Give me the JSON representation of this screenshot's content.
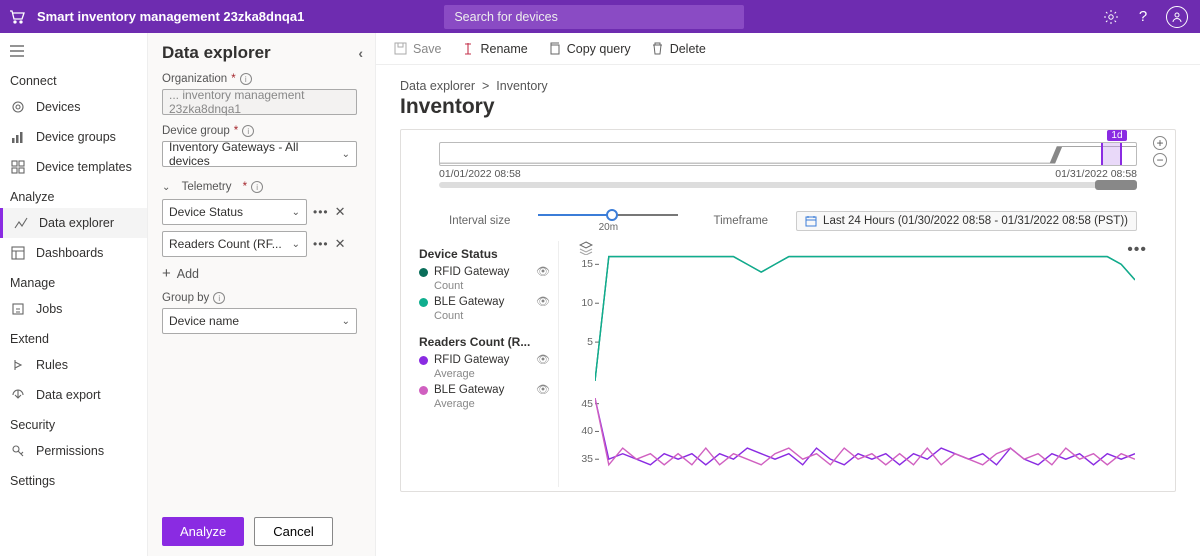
{
  "topbar": {
    "app_title": "Smart inventory management 23zka8dnqa1",
    "search_placeholder": "Search for devices"
  },
  "sidebar": {
    "sections": [
      {
        "label": "Connect",
        "items": [
          {
            "label": "Devices"
          },
          {
            "label": "Device groups"
          },
          {
            "label": "Device templates"
          }
        ]
      },
      {
        "label": "Analyze",
        "items": [
          {
            "label": "Data explorer",
            "active": true
          },
          {
            "label": "Dashboards"
          }
        ]
      },
      {
        "label": "Manage",
        "items": [
          {
            "label": "Jobs"
          }
        ]
      },
      {
        "label": "Extend",
        "items": [
          {
            "label": "Rules"
          },
          {
            "label": "Data export"
          }
        ]
      },
      {
        "label": "Security",
        "items": [
          {
            "label": "Permissions"
          }
        ]
      },
      {
        "label": "Settings",
        "items": []
      }
    ]
  },
  "explorer": {
    "title": "Data explorer",
    "org_label": "Organization",
    "org_value": "... inventory management 23zka8dnqa1",
    "dg_label": "Device group",
    "dg_value": "Inventory Gateways - All devices",
    "tel_label": "Telemetry",
    "tel1": "Device Status",
    "tel2": "Readers Count (RF...",
    "add_label": "Add",
    "group_label": "Group by",
    "group_value": "Device name",
    "analyze_btn": "Analyze",
    "cancel_btn": "Cancel"
  },
  "toolbar": {
    "save": "Save",
    "rename": "Rename",
    "copy": "Copy query",
    "delete": "Delete"
  },
  "breadcrumb": {
    "root": "Data explorer",
    "leaf": "Inventory"
  },
  "page_title": "Inventory",
  "timeline": {
    "start": "01/01/2022 08:58",
    "end": "01/31/2022 08:58",
    "badge": "1d"
  },
  "controls": {
    "interval_label": "Interval size",
    "interval_value": "20m",
    "timeframe_label": "Timeframe",
    "timeframe_value": "Last 24 Hours (01/30/2022 08:58 - 01/31/2022 08:58 (PST))"
  },
  "legend": {
    "g1": {
      "title": "Device Status",
      "s1": {
        "name": "RFID Gateway",
        "agg": "Count",
        "color": "#0a6e5a"
      },
      "s2": {
        "name": "BLE Gateway",
        "agg": "Count",
        "color": "#0fae8e"
      }
    },
    "g2": {
      "title": "Readers Count (R...",
      "s1": {
        "name": "RFID Gateway",
        "agg": "Average",
        "color": "#8a2be2"
      },
      "s2": {
        "name": "BLE Gateway",
        "agg": "Average",
        "color": "#d060c0"
      }
    }
  },
  "chart_data": [
    {
      "type": "line",
      "title": "Device Status",
      "yticks": [
        5,
        10,
        15
      ],
      "ylim": [
        0,
        18
      ],
      "series": [
        {
          "name": "RFID Gateway",
          "color": "#0a6e5a",
          "values": [
            0,
            16,
            16,
            16,
            16,
            16,
            16,
            16,
            16,
            16,
            16,
            15,
            14,
            15,
            16,
            16,
            16,
            16,
            16,
            16,
            16,
            16,
            16,
            16,
            16,
            16,
            16,
            16,
            16,
            16,
            16,
            16,
            16,
            16,
            16,
            16,
            16,
            16,
            15,
            13
          ]
        },
        {
          "name": "BLE Gateway",
          "color": "#0fae8e",
          "values": [
            0,
            16,
            16,
            16,
            16,
            16,
            16,
            16,
            16,
            16,
            16,
            15,
            14,
            15,
            16,
            16,
            16,
            16,
            16,
            16,
            16,
            16,
            16,
            16,
            16,
            16,
            16,
            16,
            16,
            16,
            16,
            16,
            16,
            16,
            16,
            16,
            16,
            16,
            15,
            13
          ]
        }
      ]
    },
    {
      "type": "line",
      "title": "Readers Count",
      "yticks": [
        35,
        40,
        45
      ],
      "ylim": [
        30,
        48
      ],
      "series": [
        {
          "name": "RFID Gateway",
          "color": "#8a2be2",
          "values": [
            46,
            35,
            36,
            35,
            34,
            36,
            35,
            36,
            34,
            36,
            35,
            37,
            36,
            35,
            36,
            34,
            37,
            35,
            34,
            36,
            35,
            36,
            34,
            36,
            35,
            37,
            36,
            35,
            36,
            34,
            37,
            35,
            34,
            36,
            35,
            36,
            34,
            36,
            35,
            36
          ]
        },
        {
          "name": "BLE Gateway",
          "color": "#d060c0",
          "values": [
            46,
            34,
            37,
            35,
            36,
            34,
            36,
            34,
            37,
            34,
            36,
            35,
            34,
            36,
            37,
            35,
            36,
            34,
            37,
            35,
            36,
            34,
            36,
            34,
            37,
            34,
            36,
            35,
            34,
            36,
            37,
            35,
            36,
            34,
            37,
            35,
            36,
            34,
            36,
            35
          ]
        }
      ]
    }
  ]
}
